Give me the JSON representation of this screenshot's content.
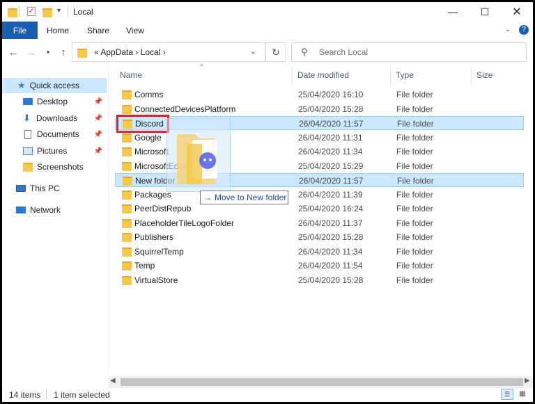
{
  "window": {
    "title": "Local"
  },
  "ribbon": {
    "file": "File",
    "home": "Home",
    "share": "Share",
    "view": "View"
  },
  "address": {
    "path": "« AppData › Local ›"
  },
  "search": {
    "placeholder": "Search Local"
  },
  "sidebar": {
    "items": [
      {
        "label": "Quick access"
      },
      {
        "label": "Desktop"
      },
      {
        "label": "Downloads"
      },
      {
        "label": "Documents"
      },
      {
        "label": "Pictures"
      },
      {
        "label": "Screenshots"
      },
      {
        "label": "This PC"
      },
      {
        "label": "Network"
      }
    ]
  },
  "columns": {
    "name": "Name",
    "date": "Date modified",
    "type": "Type",
    "size": "Size"
  },
  "files": [
    {
      "name": "Comms",
      "date": "25/04/2020 16:10",
      "type": "File folder"
    },
    {
      "name": "ConnectedDevicesPlatform",
      "date": "25/04/2020 15:28",
      "type": "File folder"
    },
    {
      "name": "Discord",
      "date": "26/04/2020 11:57",
      "type": "File folder"
    },
    {
      "name": "Google",
      "date": "26/04/2020 11:31",
      "type": "File folder"
    },
    {
      "name": "Microsoft",
      "date": "26/04/2020 11:34",
      "type": "File folder"
    },
    {
      "name": "MicrosoftEdge",
      "date": "25/04/2020 15:29",
      "type": "File folder"
    },
    {
      "name": "New folder",
      "date": "26/04/2020 11:57",
      "type": "File folder"
    },
    {
      "name": "Packages",
      "date": "26/04/2020 11:39",
      "type": "File folder"
    },
    {
      "name": "PeerDistRepub",
      "date": "25/04/2020 16:24",
      "type": "File folder"
    },
    {
      "name": "PlaceholderTileLogoFolder",
      "date": "26/04/2020 11:37",
      "type": "File folder"
    },
    {
      "name": "Publishers",
      "date": "25/04/2020 15:28",
      "type": "File folder"
    },
    {
      "name": "SquirrelTemp",
      "date": "26/04/2020 11:34",
      "type": "File folder"
    },
    {
      "name": "Temp",
      "date": "26/04/2020 11:54",
      "type": "File folder"
    },
    {
      "name": "VirtualStore",
      "date": "25/04/2020 15:28",
      "type": "File folder"
    }
  ],
  "drag": {
    "tooltip": "Move to New folder"
  },
  "status": {
    "count": "14 items",
    "selected": "1 item selected"
  },
  "colors": {
    "accent": "#1a5fb4",
    "selection": "#cce8ff",
    "highlight_border": "#e3202b"
  }
}
